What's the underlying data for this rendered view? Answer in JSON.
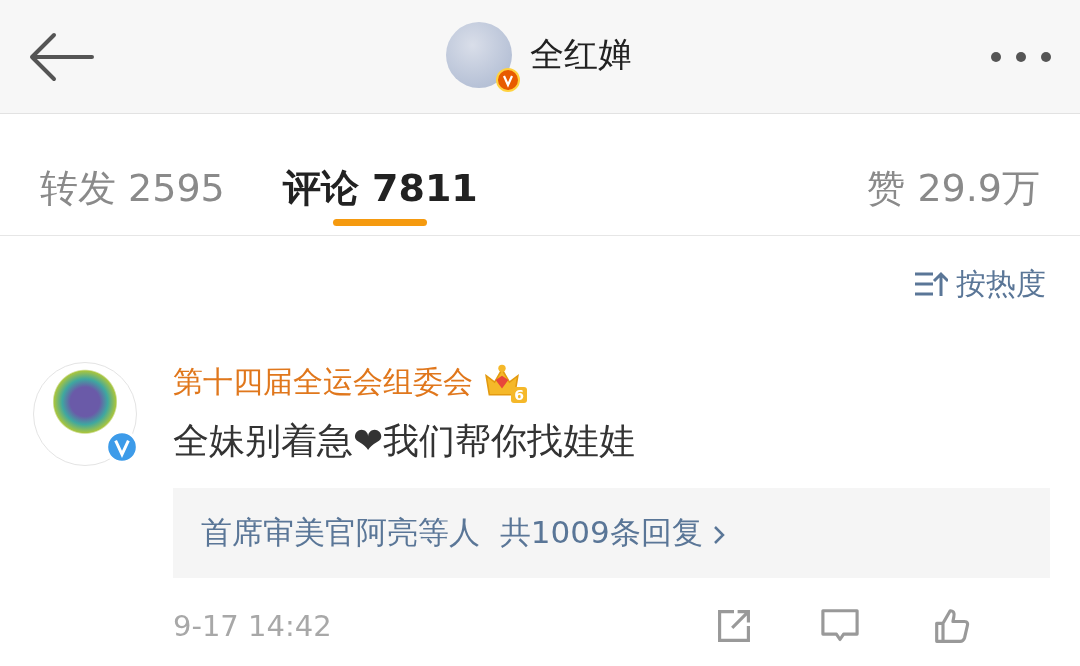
{
  "header": {
    "title": "全红婵",
    "verified": true
  },
  "tabs": [
    {
      "label": "转发",
      "count": "2595",
      "selected": false
    },
    {
      "label": "评论",
      "count": "7811",
      "selected": true
    },
    {
      "label": "赞",
      "count": "29.9万",
      "selected": false
    }
  ],
  "sort": {
    "label": "按热度"
  },
  "comments": [
    {
      "author": "第十四届全运会组委会",
      "verified": true,
      "badge_level": "6",
      "text": "全妹别着急❤我们帮你找娃娃",
      "replies": {
        "names": "首席审美官阿亮等人",
        "count": "共1009条回复"
      },
      "time": "9-17 14:42"
    }
  ]
}
